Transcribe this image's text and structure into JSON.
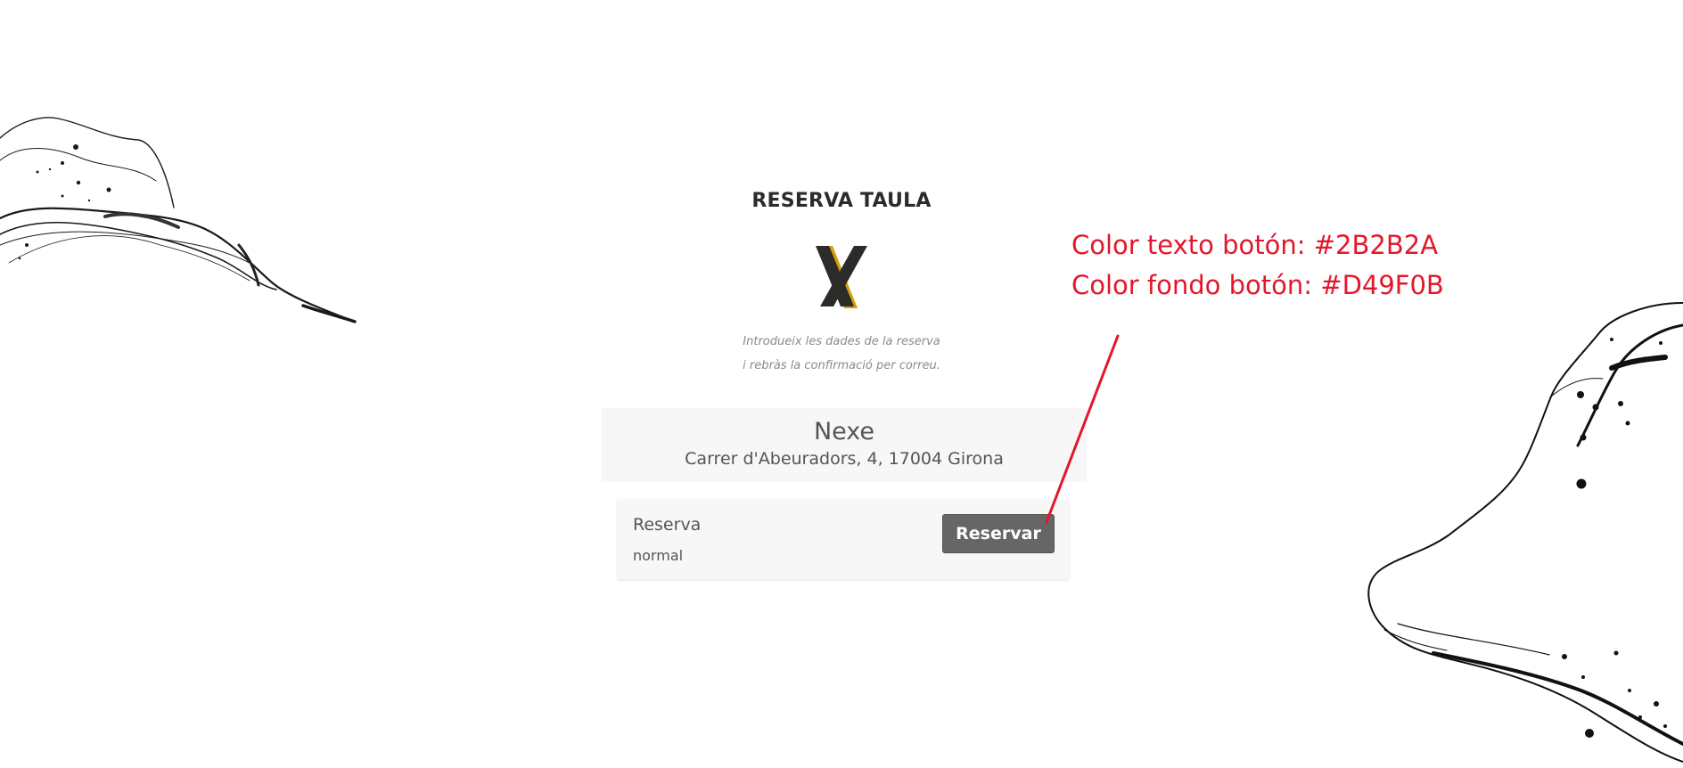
{
  "page": {
    "title": "RESERVA TAULA",
    "logo_letter": "X",
    "intro_line_1": "Introdueix les dades de la reserva",
    "intro_line_2": "i rebràs la confirmació per correu."
  },
  "restaurant": {
    "name": "Nexe",
    "address": "Carrer d'Abeuradors, 4, 17004 Girona"
  },
  "booking": {
    "label": "Reserva",
    "type": "normal",
    "button_label": "Reservar"
  },
  "annotations": {
    "line_1": "Color texto botón: #2B2B2A",
    "line_2": "Color fondo botón: #D49F0B",
    "color": "#e3172b"
  },
  "colors": {
    "text": "#2b2b2a",
    "button_bg": "#666666",
    "button_text": "#ffffff",
    "logo_accent": "#d49f0b",
    "panel_bg": "#f7f7f7"
  },
  "icons": {
    "logo": "x-logo-icon",
    "ink_left": "ink-brush-stroke-left",
    "ink_right": "ink-brush-stroke-right"
  }
}
